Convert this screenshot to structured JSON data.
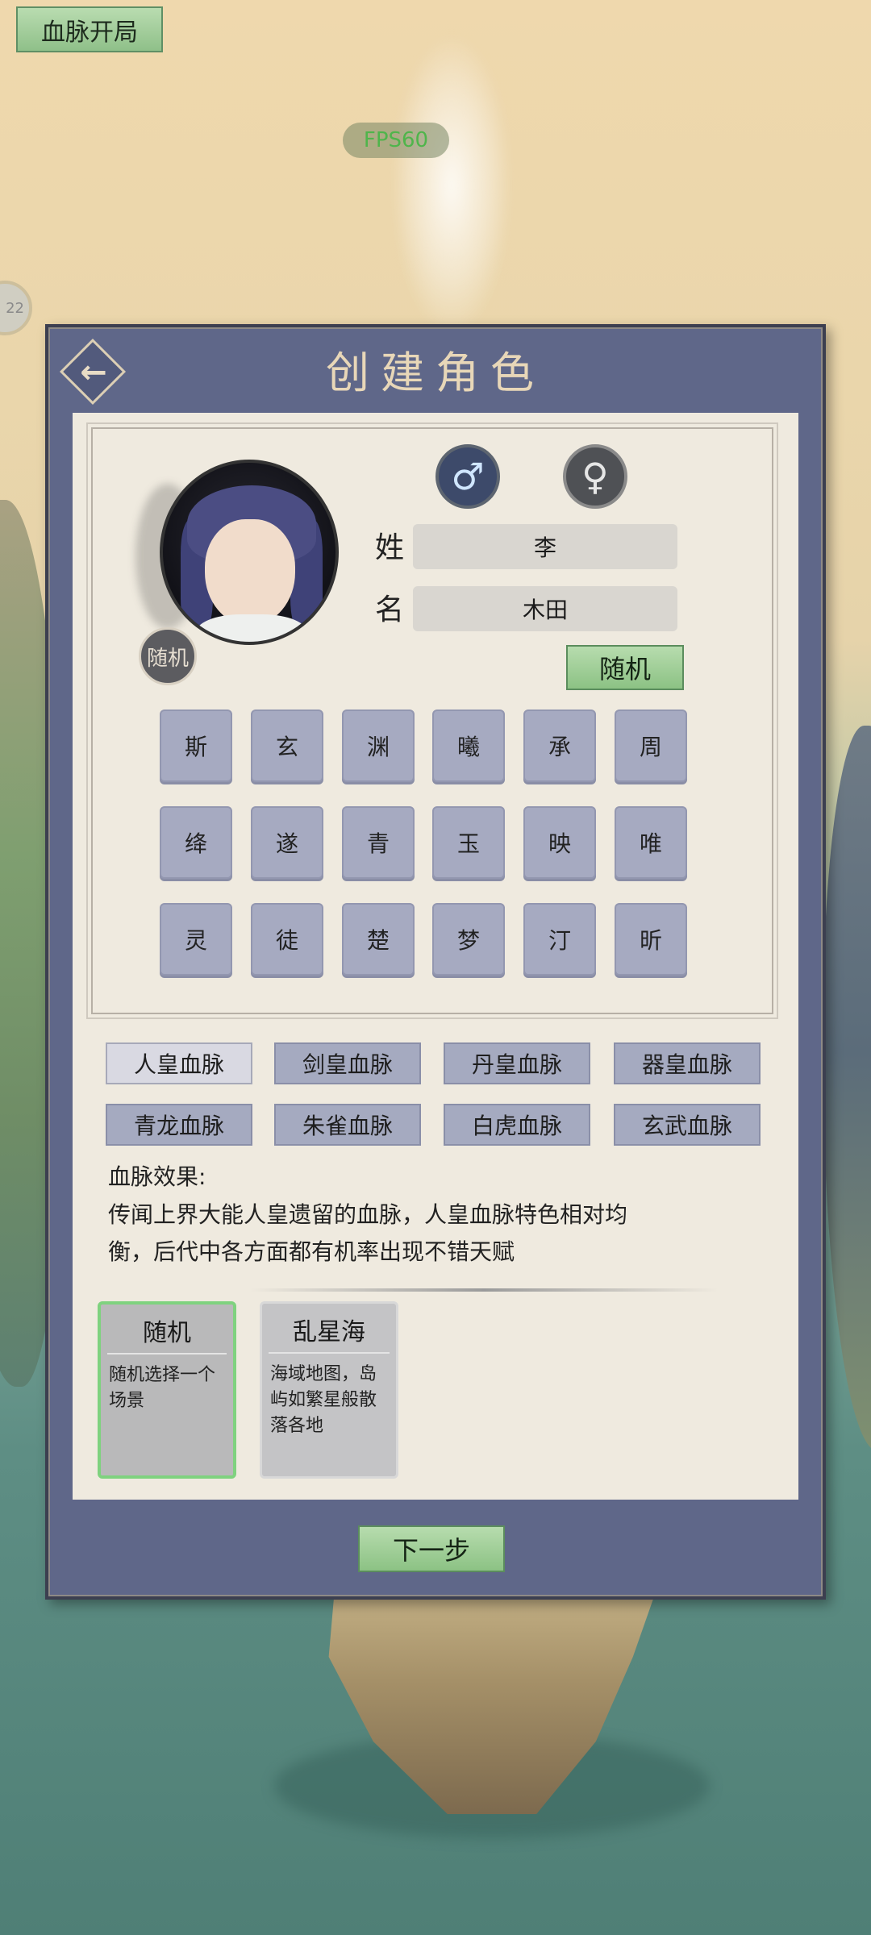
{
  "top_button": "血脉开局",
  "fps_label": "FPS60",
  "side_badge": "22",
  "panel": {
    "title": "创建角色",
    "random_seal": "随机"
  },
  "gender": {
    "male_icon": "♂",
    "female_icon": "♀"
  },
  "name_fields": {
    "surname_label": "姓",
    "surname_value": "李",
    "given_label": "名",
    "given_value": "木田",
    "random_button": "随机"
  },
  "char_grid": [
    [
      "斯",
      "玄",
      "渊",
      "曦",
      "承",
      "周"
    ],
    [
      "绛",
      "遂",
      "青",
      "玉",
      "映",
      "唯"
    ],
    [
      "灵",
      "徒",
      "楚",
      "梦",
      "汀",
      "昕"
    ]
  ],
  "bloodlines": [
    "人皇血脉",
    "剑皇血脉",
    "丹皇血脉",
    "器皇血脉",
    "青龙血脉",
    "朱雀血脉",
    "白虎血脉",
    "玄武血脉"
  ],
  "bloodline_selected_index": 0,
  "effect_title": "血脉效果:",
  "effect_lines": [
    "传闻上界大能人皇遗留的血脉，人皇血脉特色相对均",
    "衡，后代中各方面都有机率出现不错天赋"
  ],
  "scenes": [
    {
      "title": "随机",
      "desc_lines": [
        "随机选择一个",
        "场景"
      ]
    },
    {
      "title": "乱星海",
      "desc_lines": [
        "海域地图，岛",
        "屿如繁星般散",
        "落各地"
      ]
    }
  ],
  "scene_selected_index": 0,
  "next_button": "下一步",
  "colors": {
    "panel": "#5f6789",
    "content_bg": "#efeadf",
    "green_button": "#8cc284",
    "char_button": "#a6aac1",
    "selected_border": "#7fd27f"
  }
}
